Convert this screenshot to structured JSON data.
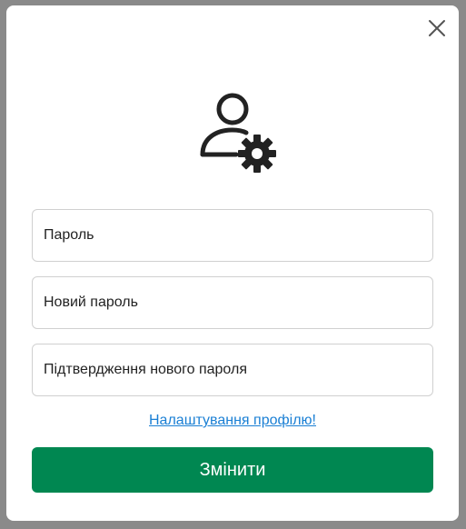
{
  "modal": {
    "close_icon": "close-icon",
    "header_icon": "user-gear-icon",
    "fields": {
      "password_placeholder": "Пароль",
      "new_password_placeholder": "Новий пароль",
      "confirm_password_placeholder": "Підтвердження нового пароля"
    },
    "profile_link": "Налаштування профілю!",
    "submit_label": "Змінити"
  },
  "colors": {
    "accent": "#008751",
    "link": "#1a7fd4",
    "overlay": "#8a8a8a"
  }
}
